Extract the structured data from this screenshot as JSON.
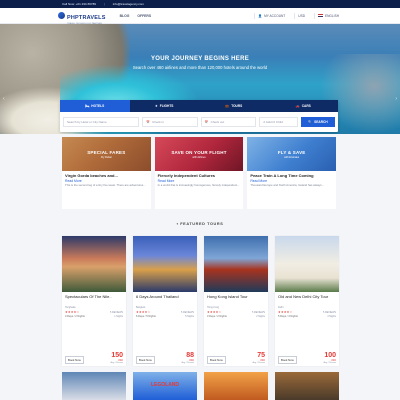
{
  "topbar": {
    "phone": "Call Now: +01 234-56789",
    "email": "info@travelagency.com"
  },
  "header": {
    "logo_name": "PHPTRAVELS",
    "logo_tagline": "TRAVEL TECHNOLOGY PARTNER",
    "nav": [
      "BLOG",
      "OFFERS"
    ],
    "account": "MY ACCOUNT",
    "currency": "USD",
    "language": "ENGLISH"
  },
  "hero": {
    "title": "YOUR JOURNEY BEGINS HERE",
    "subtitle": "Search over 460 airlines and more than 120,000 hotels around the world"
  },
  "search": {
    "tabs": [
      {
        "label": "HOTELS",
        "icon": "bed-icon",
        "active": true
      },
      {
        "label": "FLIGHTS",
        "icon": "plane-icon",
        "active": false
      },
      {
        "label": "TOURS",
        "icon": "suitcase-icon",
        "active": false
      },
      {
        "label": "CARS",
        "icon": "car-icon",
        "active": false
      }
    ],
    "location_placeholder": "Search by Hotel or City Name",
    "checkin_placeholder": "Check in",
    "checkout_placeholder": "Check out",
    "guests": "2 Adult 0 Child",
    "button": "SEARCH"
  },
  "offers": [
    {
      "banner_big": "SPECIAL FARES",
      "banner_small": "Fly Dubai",
      "title": "Virgin Gorda beaches and...",
      "read_more": "Read More",
      "text": "This is the second leg of a tiny five week. There are adventures..."
    },
    {
      "banner_big": "SAVE ON YOUR FLIGHT",
      "banner_small": "with Airlines",
      "title": "Fiercely Independent Cultures",
      "read_more": "Read More",
      "text": "In a world that is increasingly homogenous, fiercely independent..."
    },
    {
      "banner_big": "FLY & SAVE",
      "banner_small": "with Emirates",
      "title": "Peace Train A Long Time Coming",
      "read_more": "Read More",
      "text": "Thousand Europe and North America, Iceland has always..."
    }
  ],
  "featured": {
    "title": "FEATURED TOURS"
  },
  "tours": [
    {
      "name": "Spectaculars Of The Nile..",
      "location": "Hurghada",
      "stars": "★★★★☆",
      "reviews": "5 REVIEWS",
      "duration": "3 Days / 2 Nights",
      "tag": "1 Nights",
      "price": "150",
      "currency": "USD",
      "per": "Avg / Person",
      "button": "Book Now"
    },
    {
      "name": "6 Days Around Thailand",
      "location": "Bangkok",
      "stars": "★★★★☆",
      "reviews": "5 REVIEWS",
      "duration": "6 Days / 5 Nights",
      "tag": "5 Nights",
      "price": "88",
      "currency": "USD",
      "per": "Avg / Person",
      "button": "Book Now"
    },
    {
      "name": "Hong Kong Island Tour",
      "location": "Hong Kong",
      "stars": "★★★★☆",
      "reviews": "5 REVIEWS",
      "duration": "3 Days / 2 Nights",
      "tag": "2 Nights",
      "price": "75",
      "currency": "USD",
      "per": "Avg / Person",
      "button": "Book Now"
    },
    {
      "name": "Old and New Delhi City Tour",
      "location": "Delhi",
      "stars": "★★★★☆",
      "reviews": "5 REVIEWS",
      "duration": "5 Days / 4 Nights",
      "tag": "4 Nights",
      "price": "100",
      "currency": "USD",
      "per": "Avg / Person",
      "button": "Book Now"
    }
  ],
  "more_label": "LEGOLAND",
  "colors": {
    "primary": "#1f5ed7",
    "navy": "#0e2b66",
    "price_red": "#e53935"
  }
}
